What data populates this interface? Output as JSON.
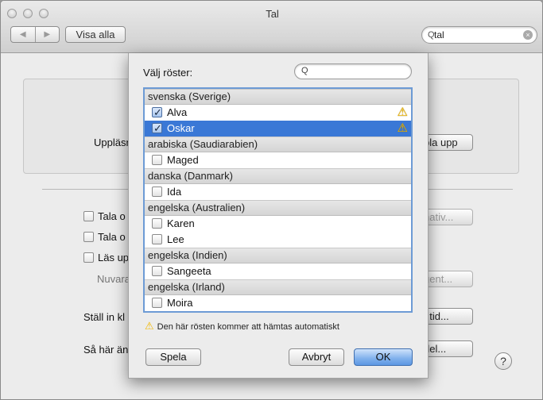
{
  "window": {
    "title": "Tal"
  },
  "toolbar": {
    "back_glyph": "◀",
    "forward_glyph": "▶",
    "show_all_label": "Visa alla",
    "search_value": "tal",
    "search_icon_glyph": "Q",
    "clear_glyph": "×"
  },
  "background": {
    "label_speech": "Uppläsn",
    "play_button_partial": "pla upp",
    "check1_label_partial": "Tala o",
    "check2_label_partial": "Tala o",
    "check3_label_partial": "Läs up",
    "current_partial": "Nuvara",
    "alt_button_partial": "nativ...",
    "agent_button_partial": "gent...",
    "set_label_partial": "Ställ in kl",
    "time_button_partial": "t tid...",
    "change_label_partial": "Så här än",
    "voiceover_button_partial": "del...",
    "help_glyph": "?"
  },
  "sheet": {
    "title": "Välj röster:",
    "search_icon_glyph": "Q",
    "groups": [
      {
        "name": "svenska (Sverige)",
        "items": [
          {
            "label": "Alva",
            "checked": true,
            "selected": false,
            "warning": true
          },
          {
            "label": "Oskar",
            "checked": true,
            "selected": true,
            "warning": true
          }
        ]
      },
      {
        "name": "arabiska (Saudiarabien)",
        "items": [
          {
            "label": "Maged",
            "checked": false,
            "selected": false,
            "warning": false
          }
        ]
      },
      {
        "name": "danska (Danmark)",
        "items": [
          {
            "label": "Ida",
            "checked": false,
            "selected": false,
            "warning": false
          }
        ]
      },
      {
        "name": "engelska (Australien)",
        "items": [
          {
            "label": "Karen",
            "checked": false,
            "selected": false,
            "warning": false
          },
          {
            "label": "Lee",
            "checked": false,
            "selected": false,
            "warning": false
          }
        ]
      },
      {
        "name": "engelska (Indien)",
        "items": [
          {
            "label": "Sangeeta",
            "checked": false,
            "selected": false,
            "warning": false
          }
        ]
      },
      {
        "name": "engelska (Irland)",
        "items": [
          {
            "label": "Moira",
            "checked": false,
            "selected": false,
            "warning": false
          }
        ]
      }
    ],
    "warning_glyph": "⚠",
    "note": "Den här rösten kommer att hämtas automatiskt",
    "play_label": "Spela",
    "cancel_label": "Avbryt",
    "ok_label": "OK"
  },
  "colors": {
    "selection": "#3a78d6",
    "focus_ring": "#6d9bd5",
    "warning": "#f2b800"
  }
}
